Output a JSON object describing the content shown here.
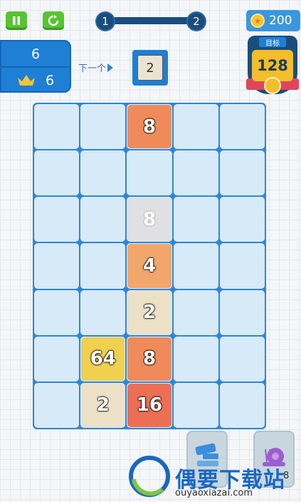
{
  "topbar": {
    "level_start": "1",
    "level_end": "2",
    "coins": "200"
  },
  "score": {
    "current": "6",
    "best": "6"
  },
  "next": {
    "label": "下一个",
    "tile_value": "2"
  },
  "target": {
    "label": "目标",
    "value": "128"
  },
  "board": {
    "rows": [
      [
        "",
        "",
        "8",
        "",
        ""
      ],
      [
        "",
        "",
        "",
        "",
        ""
      ],
      [
        "",
        "",
        "8",
        "",
        ""
      ],
      [
        "",
        "",
        "4",
        "",
        ""
      ],
      [
        "",
        "",
        "2",
        "",
        ""
      ],
      [
        "",
        "64",
        "8",
        "",
        ""
      ],
      [
        "",
        "2",
        "16",
        "",
        ""
      ]
    ],
    "ghost_cells": [
      "2-2"
    ]
  },
  "tools": {
    "snail_count": "8"
  },
  "watermark": {
    "name": "偶要下载站",
    "url": "ouyaoxiazai.com"
  },
  "colors": {
    "accent": "#1e7fd4",
    "pause_green": "#57c431",
    "board_bg": "#d7eaf8"
  },
  "icons": [
    "pause-icon",
    "restart-icon",
    "coin-icon",
    "crown-icon",
    "hammer-icon",
    "snail-icon"
  ]
}
